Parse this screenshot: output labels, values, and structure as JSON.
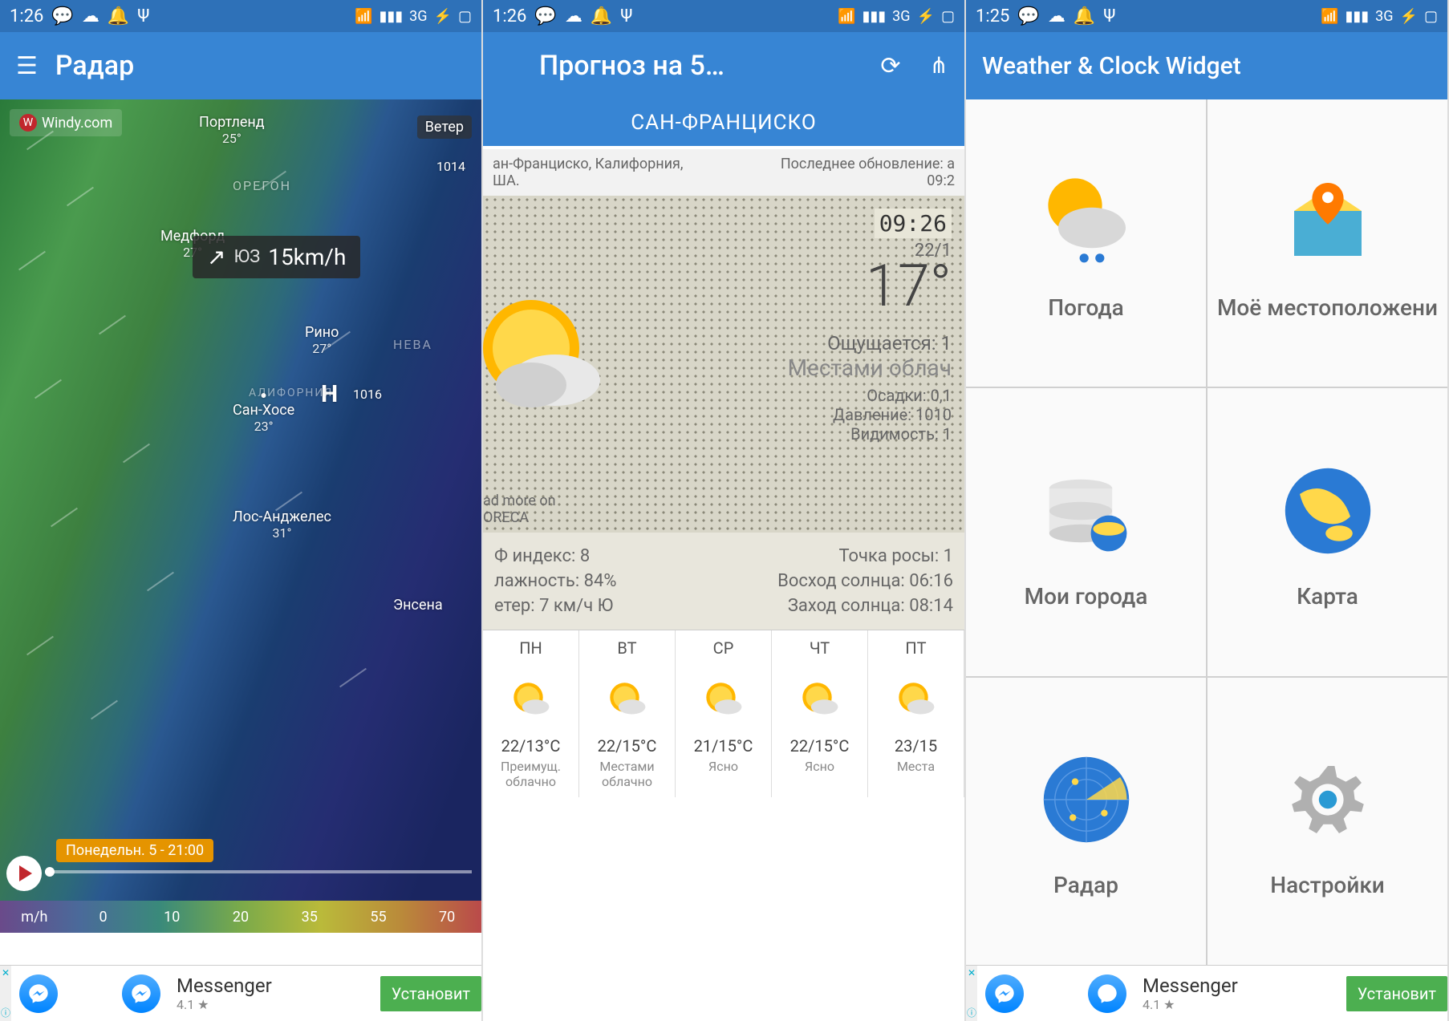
{
  "status": {
    "time1": "1:26",
    "time2": "1:26",
    "time3": "1:25",
    "net": "3G"
  },
  "screen1": {
    "title": "Радар",
    "brand": "Windy.com",
    "wind_label": "Ветер",
    "wind_dir": "ЮЗ",
    "wind_speed": "15km/h",
    "timeline": "Понедельн. 5 - 21:00",
    "scale_unit": "m/h",
    "scale": [
      "0",
      "10",
      "20",
      "35",
      "55",
      "70"
    ],
    "cities": {
      "portland": {
        "name": "Портленд",
        "t": "25°"
      },
      "medford": {
        "name": "Медфорд",
        "t": "27°"
      },
      "reno": {
        "name": "Рино",
        "t": "27°"
      },
      "sanjose": {
        "name": "Сан-Хосе",
        "t": "23°"
      },
      "la": {
        "name": "Лос-Анджелес",
        "t": "31°"
      },
      "oregon": "ОРЕГОН",
      "nevada": "НЕВА",
      "calif": "АЛИФОРНИЯ",
      "ensenada": "Энсена"
    },
    "pressure1": "1014",
    "pressure2": "1016",
    "h_label": "H"
  },
  "screen2": {
    "title": "Прогноз на 5…",
    "tab": "САН-ФРАНЦИСКО",
    "loc": "ан-Франциско, Калифорния,\nША.",
    "updated": "Последнее обновление: а\n09:2",
    "clock": "09:26",
    "date": "22/1",
    "temp": "17°",
    "feels_label": "Ощущается: 1",
    "cond": "Местами облач",
    "precip": "Осадки: 0,1",
    "pressure": "Давление: 1010",
    "visibility": "Видимость: 1",
    "uv_label": "Ф индекс:",
    "uv": "8",
    "humidity_label": "лажность:",
    "humidity": "84%",
    "wind_label": "етер:",
    "wind": "7 км/ч Ю",
    "dew_label": "Точка росы:",
    "dew": "1",
    "sunrise_label": "Восход солнца:",
    "sunrise": "06:16",
    "sunset_label": "Заход солнца:",
    "sunset": "08:14",
    "foreca": "ad more on\nORECA",
    "days": [
      {
        "d": "ПН",
        "t": "22/13°C",
        "c": "Преимущ. облачно"
      },
      {
        "d": "ВТ",
        "t": "22/15°C",
        "c": "Местами облачно"
      },
      {
        "d": "СР",
        "t": "21/15°C",
        "c": "Ясно"
      },
      {
        "d": "ЧТ",
        "t": "22/15°C",
        "c": "Ясно"
      },
      {
        "d": "ПТ",
        "t": "23/15",
        "c": "Места"
      }
    ]
  },
  "screen3": {
    "title": "Weather & Clock Widget",
    "items": {
      "weather": "Погода",
      "location": "Моё местоположени",
      "cities": "Мои города",
      "map": "Карта",
      "radar": "Радар",
      "settings": "Настройки"
    }
  },
  "ad": {
    "app": "Messenger",
    "rating": "4.1 ★",
    "btn": "Установит"
  }
}
